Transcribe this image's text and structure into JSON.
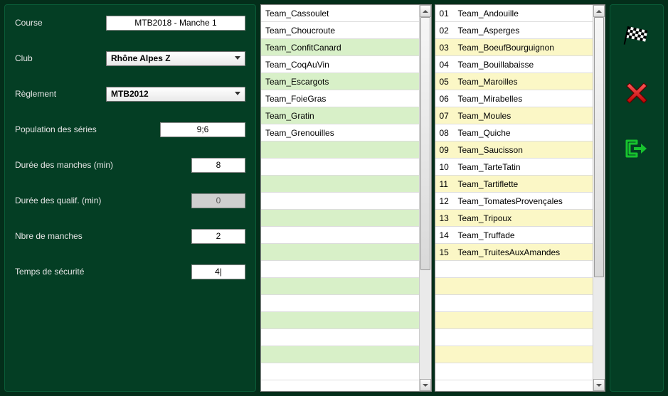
{
  "left": {
    "course_label": "Course",
    "course_value": "MTB2018 - Manche 1",
    "club_label": "Club",
    "club_value": "Rhône Alpes Z",
    "reglement_label": "Règlement",
    "reglement_value": "MTB2012",
    "pop_label": "Population des séries",
    "pop_value": "9;6",
    "duree_manches_label": "Durée des manches (min)",
    "duree_manches_value": "8",
    "duree_qualif_label": "Durée des qualif. (min)",
    "duree_qualif_value": "0",
    "nbre_manches_label": "Nbre de manches",
    "nbre_manches_value": "2",
    "securite_label": "Temps de sécurité",
    "securite_value": "4|"
  },
  "list_left": [
    {
      "label": "Team_Cassoulet",
      "color": "white"
    },
    {
      "label": "Team_Choucroute",
      "color": "white"
    },
    {
      "label": "Team_ConfitCanard",
      "color": "green"
    },
    {
      "label": "Team_CoqAuVin",
      "color": "white"
    },
    {
      "label": "Team_Escargots",
      "color": "green"
    },
    {
      "label": "Team_FoieGras",
      "color": "white"
    },
    {
      "label": "Team_Gratin",
      "color": "green"
    },
    {
      "label": "Team_Grenouilles",
      "color": "white"
    },
    {
      "label": "",
      "color": "green"
    },
    {
      "label": "",
      "color": "white"
    },
    {
      "label": "",
      "color": "green"
    },
    {
      "label": "",
      "color": "white"
    },
    {
      "label": "",
      "color": "green"
    },
    {
      "label": "",
      "color": "white"
    },
    {
      "label": "",
      "color": "green"
    },
    {
      "label": "",
      "color": "white"
    },
    {
      "label": "",
      "color": "green"
    },
    {
      "label": "",
      "color": "white"
    },
    {
      "label": "",
      "color": "green"
    },
    {
      "label": "",
      "color": "white"
    },
    {
      "label": "",
      "color": "green"
    },
    {
      "label": "",
      "color": "white"
    }
  ],
  "list_right": [
    {
      "num": "01",
      "label": "Team_Andouille",
      "color": "white"
    },
    {
      "num": "02",
      "label": "Team_Asperges",
      "color": "white"
    },
    {
      "num": "03",
      "label": "Team_BoeufBourguignon",
      "color": "yellow"
    },
    {
      "num": "04",
      "label": "Team_Bouillabaisse",
      "color": "white"
    },
    {
      "num": "05",
      "label": "Team_Maroilles",
      "color": "yellow"
    },
    {
      "num": "06",
      "label": "Team_Mirabelles",
      "color": "white"
    },
    {
      "num": "07",
      "label": "Team_Moules",
      "color": "yellow"
    },
    {
      "num": "08",
      "label": "Team_Quiche",
      "color": "white"
    },
    {
      "num": "09",
      "label": "Team_Saucisson",
      "color": "yellow"
    },
    {
      "num": "10",
      "label": "Team_TarteTatin",
      "color": "white"
    },
    {
      "num": "11",
      "label": "Team_Tartiflette",
      "color": "yellow"
    },
    {
      "num": "12",
      "label": "Team_TomatesProvençales",
      "color": "white"
    },
    {
      "num": "13",
      "label": "Team_Tripoux",
      "color": "yellow"
    },
    {
      "num": "14",
      "label": "Team_Truffade",
      "color": "white"
    },
    {
      "num": "15",
      "label": "Team_TruitesAuxAmandes",
      "color": "yellow"
    },
    {
      "num": "",
      "label": "",
      "color": "white"
    },
    {
      "num": "",
      "label": "",
      "color": "yellow"
    },
    {
      "num": "",
      "label": "",
      "color": "white"
    },
    {
      "num": "",
      "label": "",
      "color": "yellow"
    },
    {
      "num": "",
      "label": "",
      "color": "white"
    },
    {
      "num": "",
      "label": "",
      "color": "yellow"
    },
    {
      "num": "",
      "label": "",
      "color": "white"
    }
  ]
}
